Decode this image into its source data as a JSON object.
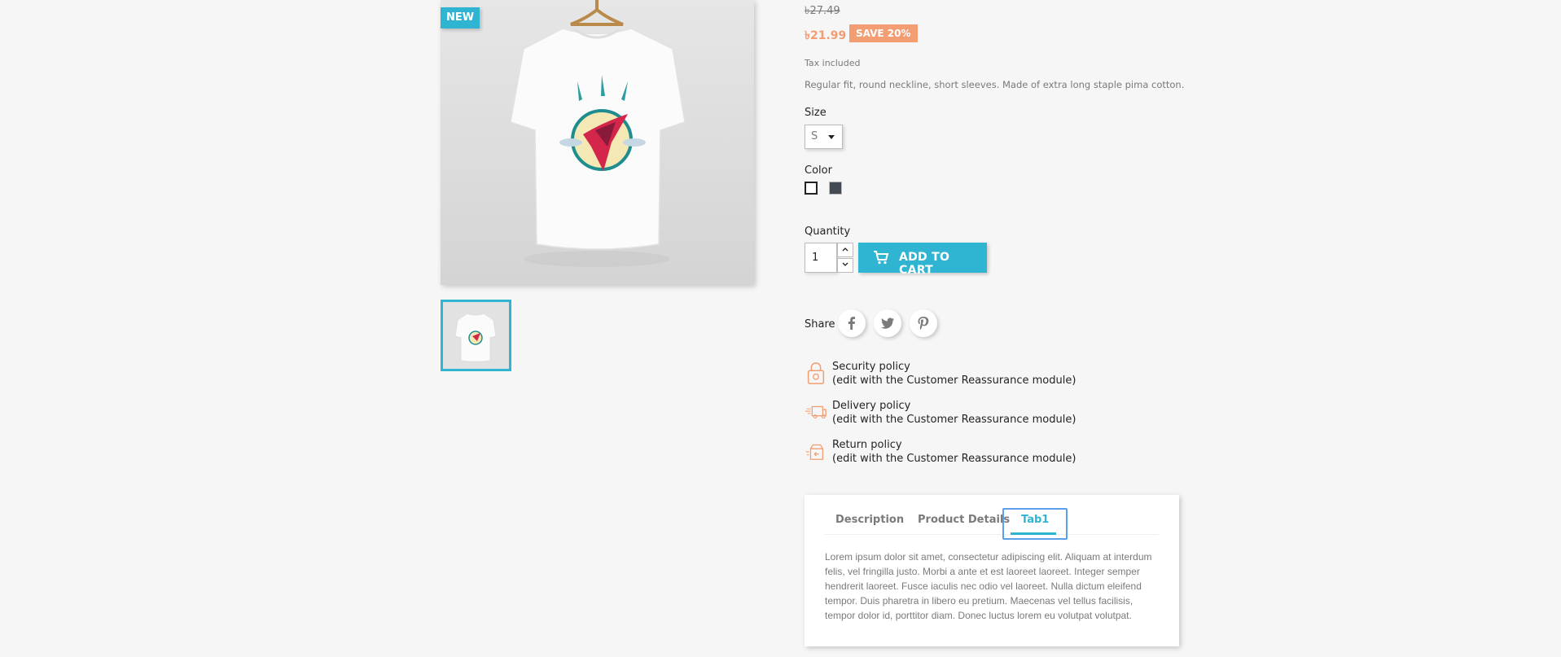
{
  "product": {
    "badge": "NEW",
    "old_price": "৳27.49",
    "price": "৳21.99",
    "discount": "SAVE 20%",
    "tax_note": "Tax included",
    "description": "Regular fit, round neckline, short sleeves. Made of extra long staple pima cotton."
  },
  "variants": {
    "size_label": "Size",
    "size_value": "S",
    "color_label": "Color",
    "colors": [
      {
        "name": "White",
        "hex": "#ffffff",
        "selected": true
      },
      {
        "name": "Black",
        "hex": "#434a54",
        "selected": false
      }
    ]
  },
  "cart": {
    "quantity_label": "Quantity",
    "quantity_value": "1",
    "add_to_cart": "ADD TO CART"
  },
  "share": {
    "label": "Share",
    "networks": [
      "facebook-icon",
      "twitter-icon",
      "pinterest-icon"
    ]
  },
  "reassurance": [
    {
      "icon": "lock-icon",
      "title": "Security policy",
      "subtitle": "(edit with the Customer Reassurance module)"
    },
    {
      "icon": "truck-icon",
      "title": "Delivery policy",
      "subtitle": "(edit with the Customer Reassurance module)"
    },
    {
      "icon": "return-box-icon",
      "title": "Return policy",
      "subtitle": "(edit with the Customer Reassurance module)"
    }
  ],
  "tabs": {
    "items": [
      "Description",
      "Product Details",
      "Tab1"
    ],
    "active": "Tab1",
    "content": "Lorem ipsum dolor sit amet, consectetur adipiscing elit. Aliquam at interdum felis, vel fringilla justo. Morbi a ante et est laoreet laoreet. Integer semper hendrerit laoreet. Fusce iaculis nec odio vel laoreet. Nulla dictum eleifend tempor. Duis pharetra in libero eu pretium. Maecenas vel tellus facilisis, tempor dolor id, porttitor diam. Donec luctus lorem eu volutpat volutpat."
  },
  "colors": {
    "accent": "#2fb5d2",
    "discount": "#f39d72",
    "focus": "#5aa0ee"
  }
}
